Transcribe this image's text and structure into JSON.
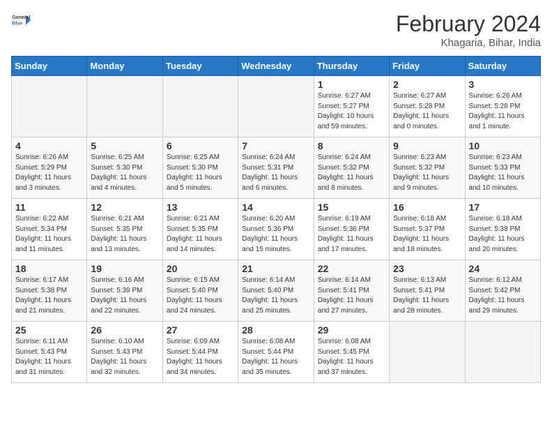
{
  "header": {
    "logo_general": "General",
    "logo_blue": "Blue",
    "month_year": "February 2024",
    "location": "Khagaria, Bihar, India"
  },
  "weekdays": [
    "Sunday",
    "Monday",
    "Tuesday",
    "Wednesday",
    "Thursday",
    "Friday",
    "Saturday"
  ],
  "weeks": [
    [
      {
        "day": "",
        "info": ""
      },
      {
        "day": "",
        "info": ""
      },
      {
        "day": "",
        "info": ""
      },
      {
        "day": "",
        "info": ""
      },
      {
        "day": "1",
        "info": "Sunrise: 6:27 AM\nSunset: 5:27 PM\nDaylight: 10 hours\nand 59 minutes."
      },
      {
        "day": "2",
        "info": "Sunrise: 6:27 AM\nSunset: 5:28 PM\nDaylight: 11 hours\nand 0 minutes."
      },
      {
        "day": "3",
        "info": "Sunrise: 6:26 AM\nSunset: 5:28 PM\nDaylight: 11 hours\nand 1 minute."
      }
    ],
    [
      {
        "day": "4",
        "info": "Sunrise: 6:26 AM\nSunset: 5:29 PM\nDaylight: 11 hours\nand 3 minutes."
      },
      {
        "day": "5",
        "info": "Sunrise: 6:25 AM\nSunset: 5:30 PM\nDaylight: 11 hours\nand 4 minutes."
      },
      {
        "day": "6",
        "info": "Sunrise: 6:25 AM\nSunset: 5:30 PM\nDaylight: 11 hours\nand 5 minutes."
      },
      {
        "day": "7",
        "info": "Sunrise: 6:24 AM\nSunset: 5:31 PM\nDaylight: 11 hours\nand 6 minutes."
      },
      {
        "day": "8",
        "info": "Sunrise: 6:24 AM\nSunset: 5:32 PM\nDaylight: 11 hours\nand 8 minutes."
      },
      {
        "day": "9",
        "info": "Sunrise: 6:23 AM\nSunset: 5:32 PM\nDaylight: 11 hours\nand 9 minutes."
      },
      {
        "day": "10",
        "info": "Sunrise: 6:23 AM\nSunset: 5:33 PM\nDaylight: 11 hours\nand 10 minutes."
      }
    ],
    [
      {
        "day": "11",
        "info": "Sunrise: 6:22 AM\nSunset: 5:34 PM\nDaylight: 11 hours\nand 11 minutes."
      },
      {
        "day": "12",
        "info": "Sunrise: 6:21 AM\nSunset: 5:35 PM\nDaylight: 11 hours\nand 13 minutes."
      },
      {
        "day": "13",
        "info": "Sunrise: 6:21 AM\nSunset: 5:35 PM\nDaylight: 11 hours\nand 14 minutes."
      },
      {
        "day": "14",
        "info": "Sunrise: 6:20 AM\nSunset: 5:36 PM\nDaylight: 11 hours\nand 15 minutes."
      },
      {
        "day": "15",
        "info": "Sunrise: 6:19 AM\nSunset: 5:36 PM\nDaylight: 11 hours\nand 17 minutes."
      },
      {
        "day": "16",
        "info": "Sunrise: 6:18 AM\nSunset: 5:37 PM\nDaylight: 11 hours\nand 18 minutes."
      },
      {
        "day": "17",
        "info": "Sunrise: 6:18 AM\nSunset: 5:38 PM\nDaylight: 11 hours\nand 20 minutes."
      }
    ],
    [
      {
        "day": "18",
        "info": "Sunrise: 6:17 AM\nSunset: 5:38 PM\nDaylight: 11 hours\nand 21 minutes."
      },
      {
        "day": "19",
        "info": "Sunrise: 6:16 AM\nSunset: 5:39 PM\nDaylight: 11 hours\nand 22 minutes."
      },
      {
        "day": "20",
        "info": "Sunrise: 6:15 AM\nSunset: 5:40 PM\nDaylight: 11 hours\nand 24 minutes."
      },
      {
        "day": "21",
        "info": "Sunrise: 6:14 AM\nSunset: 5:40 PM\nDaylight: 11 hours\nand 25 minutes."
      },
      {
        "day": "22",
        "info": "Sunrise: 6:14 AM\nSunset: 5:41 PM\nDaylight: 11 hours\nand 27 minutes."
      },
      {
        "day": "23",
        "info": "Sunrise: 6:13 AM\nSunset: 5:41 PM\nDaylight: 11 hours\nand 28 minutes."
      },
      {
        "day": "24",
        "info": "Sunrise: 6:12 AM\nSunset: 5:42 PM\nDaylight: 11 hours\nand 29 minutes."
      }
    ],
    [
      {
        "day": "25",
        "info": "Sunrise: 6:11 AM\nSunset: 5:43 PM\nDaylight: 11 hours\nand 31 minutes."
      },
      {
        "day": "26",
        "info": "Sunrise: 6:10 AM\nSunset: 5:43 PM\nDaylight: 11 hours\nand 32 minutes."
      },
      {
        "day": "27",
        "info": "Sunrise: 6:09 AM\nSunset: 5:44 PM\nDaylight: 11 hours\nand 34 minutes."
      },
      {
        "day": "28",
        "info": "Sunrise: 6:08 AM\nSunset: 5:44 PM\nDaylight: 11 hours\nand 35 minutes."
      },
      {
        "day": "29",
        "info": "Sunrise: 6:08 AM\nSunset: 5:45 PM\nDaylight: 11 hours\nand 37 minutes."
      },
      {
        "day": "",
        "info": ""
      },
      {
        "day": "",
        "info": ""
      }
    ]
  ]
}
